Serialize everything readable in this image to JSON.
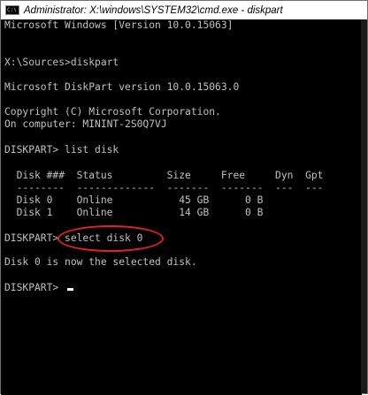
{
  "window": {
    "title_icon": "cmd-icon",
    "title": "Administrator: X:\\windows\\SYSTEM32\\cmd.exe - diskpart",
    "accent_color": "#e4202a"
  },
  "console": {
    "lines": [
      "Microsoft Windows [Version 10.0.15063]",
      "",
      "",
      "X:\\Sources>diskpart",
      "",
      "Microsoft DiskPart version 10.0.15063.0",
      "",
      "Copyright (C) Microsoft Corporation.",
      "On computer: MININT-2S0Q7VJ",
      "",
      "DISKPART> list disk",
      "",
      "  Disk ###  Status         Size     Free     Dyn  Gpt",
      "  --------  -------------  -------  -------  ---  ---",
      "  Disk 0    Online           45 GB      0 B",
      "  Disk 1    Online           14 GB      0 B",
      "",
      "DISKPART> select disk 0",
      "",
      "Disk 0 is now the selected disk.",
      "",
      "DISKPART> "
    ]
  }
}
